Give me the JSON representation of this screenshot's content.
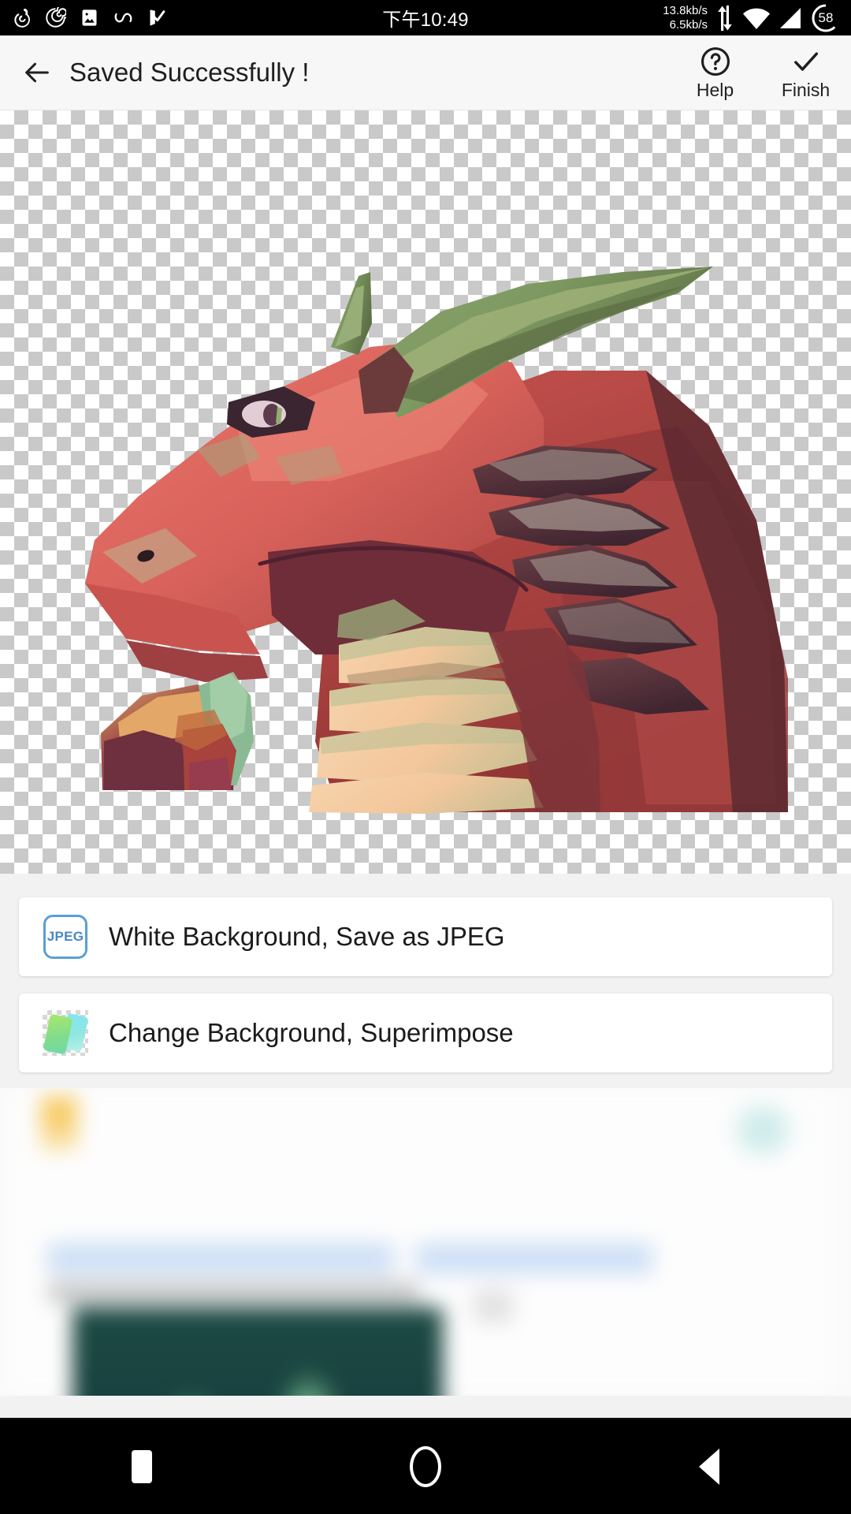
{
  "status_bar": {
    "time": "下午10:49",
    "network_up": "13.8kb/s",
    "network_down": "6.5kb/s",
    "battery_percent": "58",
    "left_icons": [
      "netease-music-icon",
      "spiral-app-icon",
      "gallery-icon",
      "infinity-app-icon",
      "checkmark-app-icon"
    ],
    "right_icons": [
      "data-transfer-icon",
      "wifi-icon",
      "cellular-signal-icon",
      "battery-icon"
    ]
  },
  "app_bar": {
    "back_icon": "arrow-left-icon",
    "title": "Saved Successfully !",
    "actions": [
      {
        "label": "Help",
        "icon": "help-circle-icon"
      },
      {
        "label": "Finish",
        "icon": "check-icon"
      }
    ]
  },
  "canvas": {
    "transparency_pattern": "checkerboard",
    "artwork": "red-dragon-head-profile"
  },
  "options": [
    {
      "label": "White Background, Save as JPEG",
      "icon": "jpeg-badge-icon",
      "badge_text": "JPEG",
      "accent_color": "#5a9fd4"
    },
    {
      "label": "Change Background, Superimpose",
      "icon": "layered-cards-icon",
      "accent_color": "#8fe8a0"
    }
  ],
  "advertisement": {
    "state": "blurred",
    "cta_color": "#1b6cf5"
  },
  "nav_bar": {
    "buttons": [
      {
        "name": "recents",
        "icon": "square-icon"
      },
      {
        "name": "home",
        "icon": "circle-icon"
      },
      {
        "name": "back",
        "icon": "triangle-left-icon"
      }
    ]
  }
}
